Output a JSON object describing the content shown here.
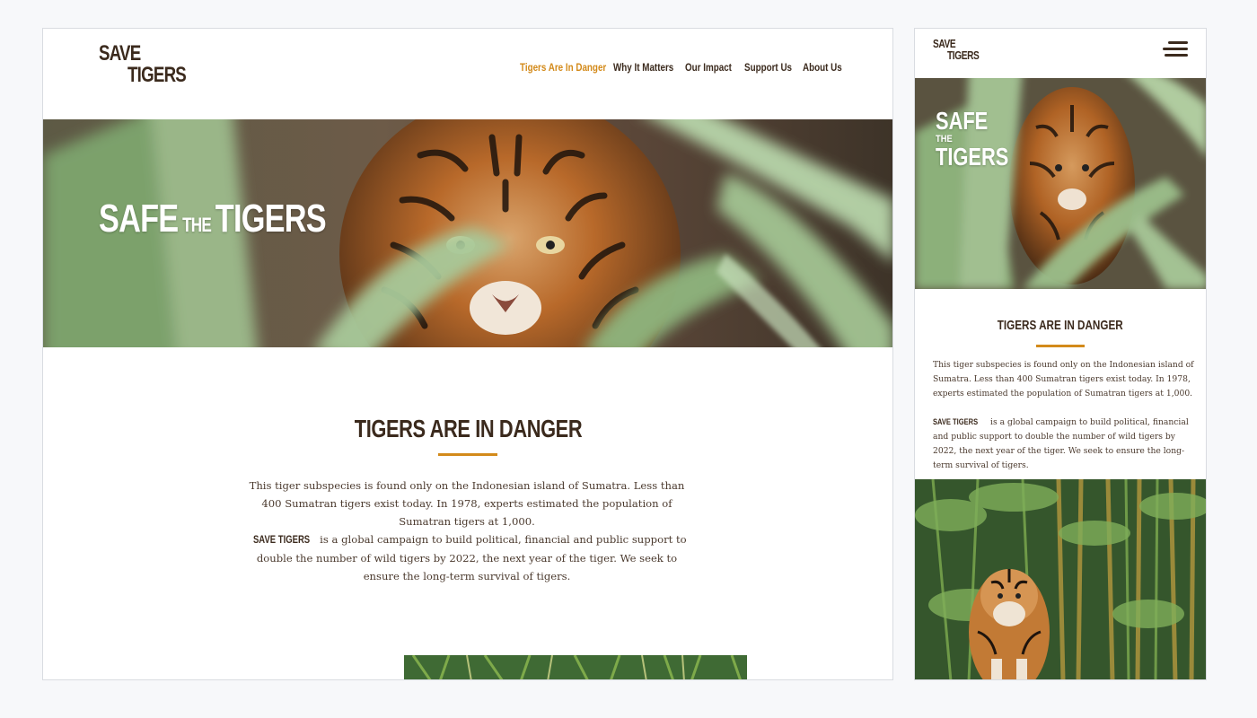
{
  "site": {
    "logo_line1": "SAVE",
    "logo_line2": "TIGERS"
  },
  "nav": {
    "items": [
      {
        "label": "Tigers Are In Danger",
        "active": true
      },
      {
        "label": "Why It Matters",
        "active": false
      },
      {
        "label": "Our Impact",
        "active": false
      },
      {
        "label": "Support Us",
        "active": false
      },
      {
        "label": "About Us",
        "active": false
      }
    ]
  },
  "hero": {
    "word1": "SAFE",
    "word2": "THE",
    "word3": "TIGERS"
  },
  "section": {
    "heading": "TIGERS ARE IN DANGER",
    "paragraph1": "This tiger subspecies is found only on the Indonesian island of Sumatra. Less than 400 Sumatran tigers exist today. In 1978, experts estimated the population of Sumatran tigers at 1,000.",
    "brand": "SAVE TIGERS",
    "paragraph2": " is a global campaign to build political, financial and public support to double the number of wild tigers by 2022, the next year of the tiger. We seek to ensure the long-term survival of tigers."
  },
  "colors": {
    "accent": "#d38a1a",
    "text_dark": "#3b2a1d",
    "background": "#f7f8fa"
  },
  "icons": {
    "menu": "hamburger-menu-icon"
  }
}
